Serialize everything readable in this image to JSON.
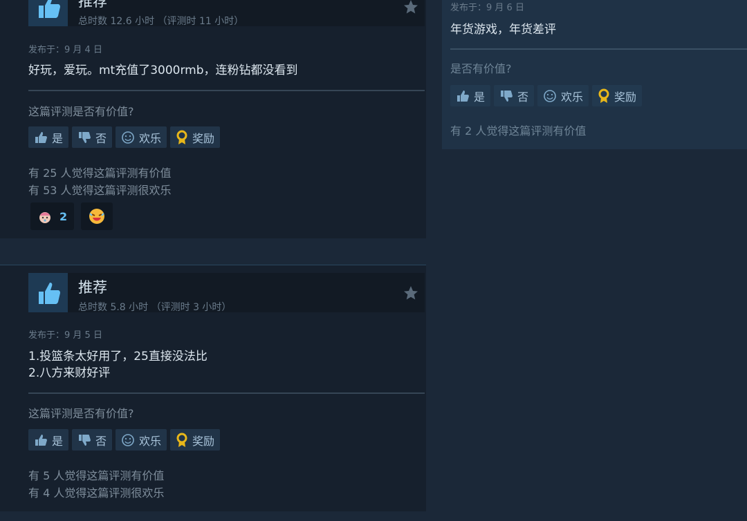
{
  "review1": {
    "title": "推荐",
    "hours": "总时数 12.6 小时 （评测时 11 小时）",
    "posted": "发布于：9 月 4 日",
    "body": "好玩，爱玩。mt充值了3000rmb，连粉钻都没看到",
    "helpful_question": "这篇评测是否有价值?",
    "buttons": {
      "yes": "是",
      "no": "否",
      "funny": "欢乐",
      "award": "奖励"
    },
    "helpful_count": "有 25 人觉得这篇评测有价值",
    "funny_count": "有 53 人觉得这篇评测很欢乐",
    "reactions": [
      {
        "icon": "baby-face-icon",
        "count": "2"
      },
      {
        "icon": "laughing-emoji-icon",
        "count": ""
      }
    ]
  },
  "review2": {
    "title": "推荐",
    "hours": "总时数 5.8 小时 （评测时 3 小时）",
    "posted": "发布于：9 月 5 日",
    "body_line1": "1.投篮条太好用了，25直接没法比",
    "body_line2": "2.八方来财好评",
    "helpful_question": "这篇评测是否有价值?",
    "buttons": {
      "yes": "是",
      "no": "否",
      "funny": "欢乐",
      "award": "奖励"
    },
    "helpful_count": "有 5 人觉得这篇评测有价值",
    "funny_count": "有 4 人觉得这篇评测很欢乐"
  },
  "review3": {
    "posted": "发布于：9 月 6 日",
    "body": "年货游戏，年货差评",
    "helpful_question": "是否有价值?",
    "buttons": {
      "yes": "是",
      "no": "否",
      "funny": "欢乐",
      "award": "奖励"
    },
    "helpful_count": "有 2 人觉得这篇评测有价值"
  },
  "colors": {
    "background": "#1b2838",
    "card": "#16202d",
    "accent": "#66c0f4",
    "award": "#e8b71a"
  }
}
